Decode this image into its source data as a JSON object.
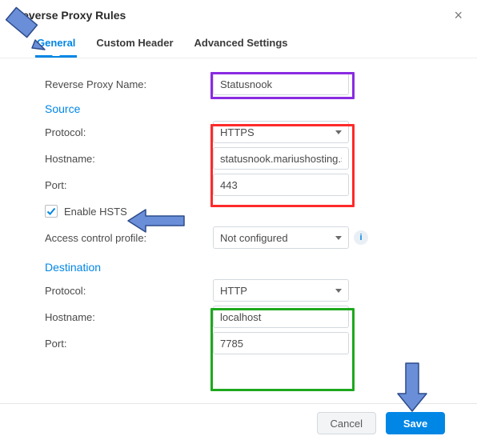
{
  "window": {
    "title": "Reverse Proxy Rules"
  },
  "tabs": {
    "general": "General",
    "custom_header": "Custom Header",
    "advanced": "Advanced Settings",
    "active": "general"
  },
  "form": {
    "reverse_proxy_name": {
      "label": "Reverse Proxy Name:",
      "value": "Statusnook"
    },
    "source_title": "Source",
    "src_protocol": {
      "label": "Protocol:",
      "value": "HTTPS"
    },
    "src_hostname": {
      "label": "Hostname:",
      "value": "statusnook.mariushosting.s"
    },
    "src_port": {
      "label": "Port:",
      "value": "443"
    },
    "enable_hsts": {
      "label": "Enable HSTS",
      "checked": true
    },
    "access_control": {
      "label": "Access control profile:",
      "value": "Not configured"
    },
    "destination_title": "Destination",
    "dst_protocol": {
      "label": "Protocol:",
      "value": "HTTP"
    },
    "dst_hostname": {
      "label": "Hostname:",
      "value": "localhost"
    },
    "dst_port": {
      "label": "Port:",
      "value": "7785"
    }
  },
  "footer": {
    "cancel": "Cancel",
    "save": "Save"
  },
  "colors": {
    "purple": "#8a2be2",
    "red": "#ff2a2a",
    "green": "#1ea81e",
    "arrow": "#6a8fd8",
    "arrow_stroke": "#2c4b8a"
  }
}
